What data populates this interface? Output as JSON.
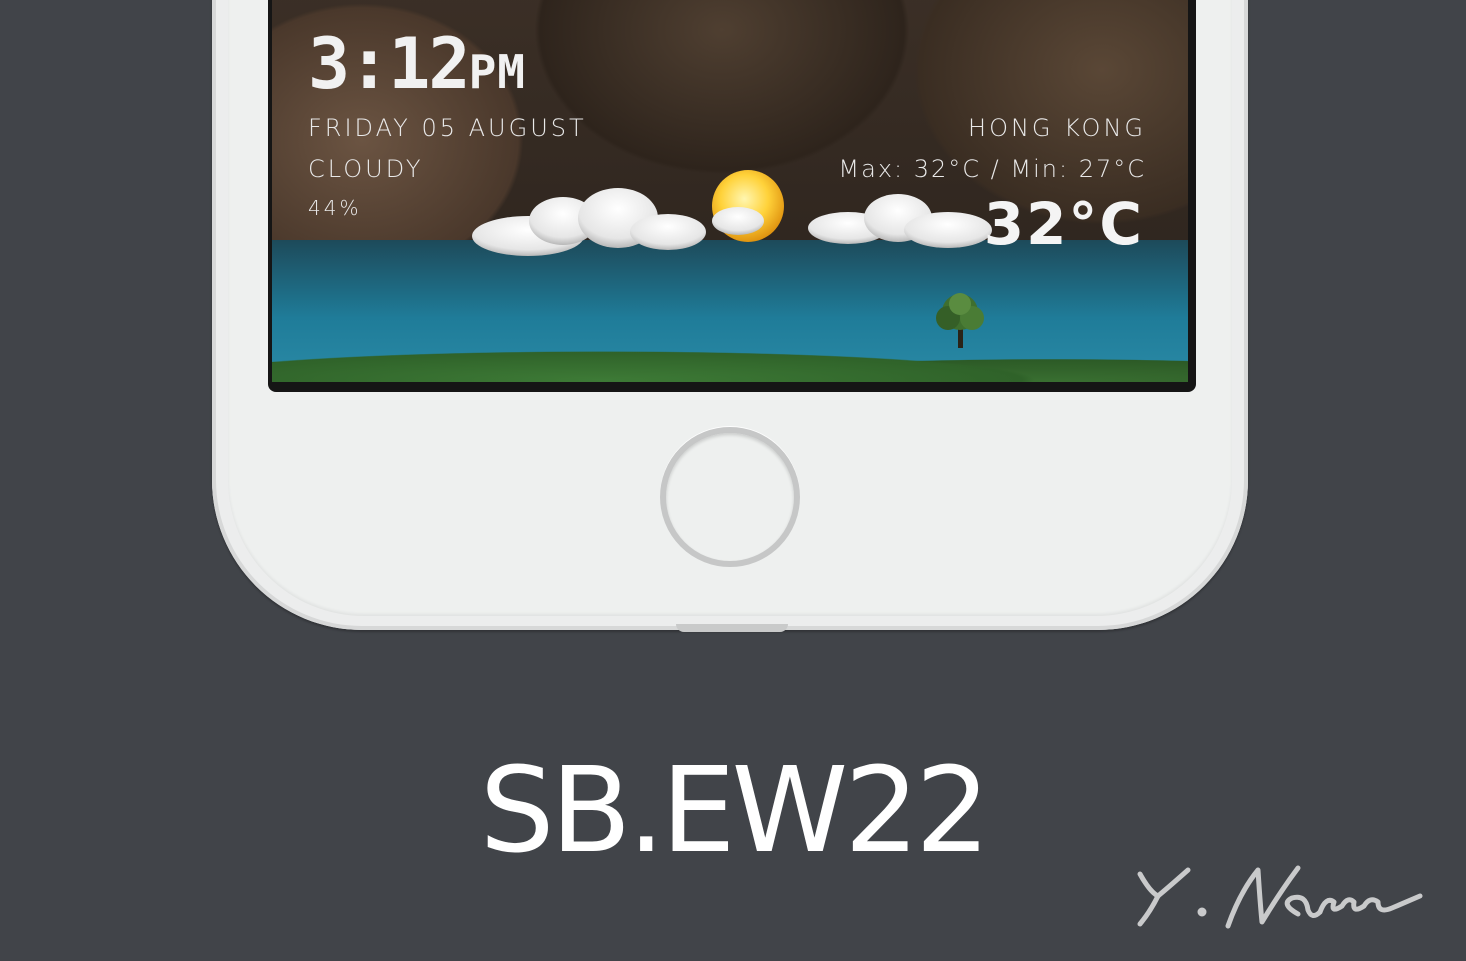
{
  "widget": {
    "time": "3:12",
    "ampm": "PM",
    "date": "FRIDAY 05 AUGUST",
    "condition": "CLOUDY",
    "humidity": "44%",
    "city": "HONG KONG",
    "range": "Max: 32°C / Min: 27°C",
    "temperature": "32°C",
    "weather_icon": "sun-behind-clouds-icon"
  },
  "product": {
    "title": "SB.EW22",
    "signature": "Y.Nam"
  },
  "colors": {
    "background": "#414449",
    "phone_body": "#eceded",
    "text": "#ffffff",
    "sky": "#1f7c99"
  }
}
